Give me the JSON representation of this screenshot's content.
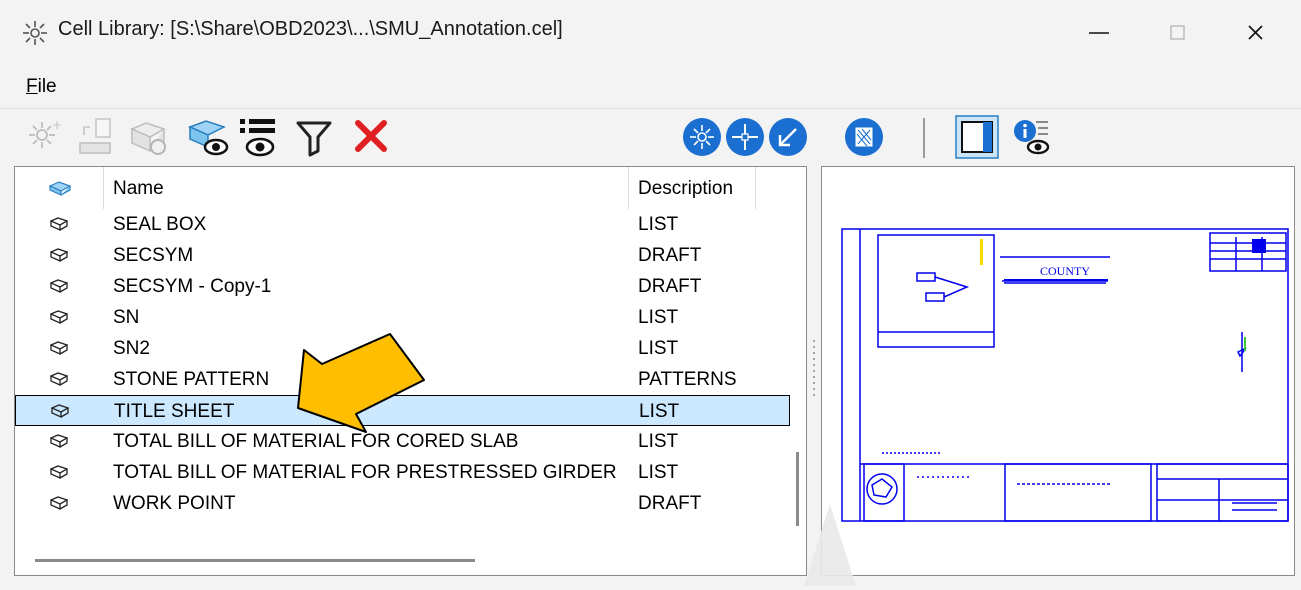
{
  "window": {
    "title": "Cell Library: [S:\\Share\\OBD2023\\...\\SMU_Annotation.cel]",
    "app_icon": "cell-library-icon",
    "controls": [
      "minimize-icon",
      "maximize-icon",
      "close-icon"
    ]
  },
  "menu": {
    "file_label": "File",
    "file_accel": "F",
    "file_rest": "ile"
  },
  "toolbar": {
    "left_icons": [
      "create-cell-icon",
      "export-cell-icon",
      "update-cell-icon",
      "show-cells-icon",
      "show-details-icon",
      "filter-icon",
      "delete-icon"
    ],
    "right_icons": [
      "placement-cell-icon",
      "point-cell-icon",
      "terminator-cell-icon",
      "pattern-cell-icon",
      "preview-toggle-icon",
      "info-icon"
    ],
    "colors": {
      "blue_button": "#1a6fd1",
      "delete_red": "#e02020"
    }
  },
  "list": {
    "header": {
      "name": "Name",
      "description": "Description"
    },
    "rows": [
      {
        "name": "SEAL BOX",
        "description": "LIST"
      },
      {
        "name": "SECSYM",
        "description": "DRAFT"
      },
      {
        "name": "SECSYM - Copy-1",
        "description": "DRAFT"
      },
      {
        "name": "SN",
        "description": "LIST"
      },
      {
        "name": "SN2",
        "description": "LIST"
      },
      {
        "name": "STONE PATTERN",
        "description": "PATTERNS"
      },
      {
        "name": "TITLE SHEET",
        "description": "LIST",
        "selected": true
      },
      {
        "name": "TOTAL BILL OF MATERIAL FOR CORED SLAB",
        "description": "LIST"
      },
      {
        "name": "TOTAL BILL OF MATERIAL FOR PRESTRESSED GIRDER",
        "description": "LIST"
      },
      {
        "name": "WORK POINT",
        "description": "DRAFT"
      }
    ],
    "selection_color": "#cce8ff"
  },
  "preview": {
    "line_color": "#0000ee",
    "title_block_text": "COUNTY",
    "arrow_color": "#ffbf00"
  }
}
